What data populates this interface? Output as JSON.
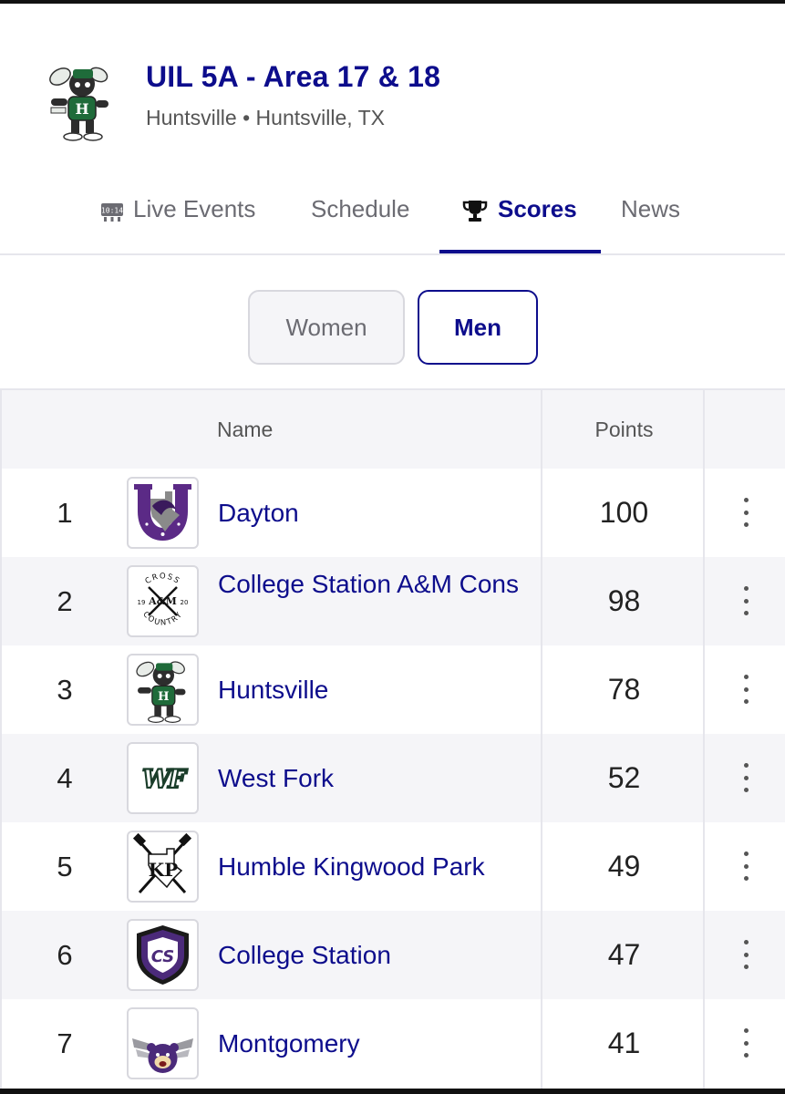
{
  "header": {
    "title": "UIL 5A - Area 17 & 18",
    "subtitle": "Huntsville • Huntsville, TX",
    "logo_icon": "hornet-mascot-logo"
  },
  "tabs": [
    {
      "label": "Live Events",
      "icon": "scoreboard-icon",
      "icon_text": "10:14",
      "active": false
    },
    {
      "label": "Schedule",
      "active": false
    },
    {
      "label": "Scores",
      "icon": "trophy-icon",
      "active": true
    },
    {
      "label": "News",
      "active": false
    }
  ],
  "gender_toggle": {
    "women": "Women",
    "men": "Men",
    "selected": "Men"
  },
  "table": {
    "columns": {
      "name": "Name",
      "points": "Points"
    },
    "rows": [
      {
        "rank": "1",
        "name": "Dayton",
        "points": "100",
        "logo": "dayton-horseshoe-logo"
      },
      {
        "rank": "2",
        "name": "College Station A&M Cons",
        "points": "98",
        "logo": "cross-country-logo",
        "logo_text": {
          "top": "CROSS",
          "mid": "A&M",
          "bottom": "COUNTRY",
          "left": "19",
          "right": "20"
        }
      },
      {
        "rank": "3",
        "name": "Huntsville",
        "points": "78",
        "logo": "hornet-mascot-logo"
      },
      {
        "rank": "4",
        "name": "West Fork",
        "points": "52",
        "logo": "west-fork-logo",
        "logo_text": "WF"
      },
      {
        "rank": "5",
        "name": "Humble Kingwood Park",
        "points": "49",
        "logo": "kingwood-park-logo",
        "logo_text": "KP"
      },
      {
        "rank": "6",
        "name": "College Station",
        "points": "47",
        "logo": "college-station-shield-logo",
        "logo_text": "CS"
      },
      {
        "rank": "7",
        "name": "Montgomery",
        "points": "41",
        "logo": "montgomery-bear-logo"
      }
    ]
  },
  "colors": {
    "brand": "#0d0d8c",
    "muted_text": "#6b6b72",
    "alt_row": "#f5f5f8",
    "border": "#e6e6ec",
    "dayton_purple": "#5b2a86",
    "hornet_green": "#1f6b3a"
  }
}
